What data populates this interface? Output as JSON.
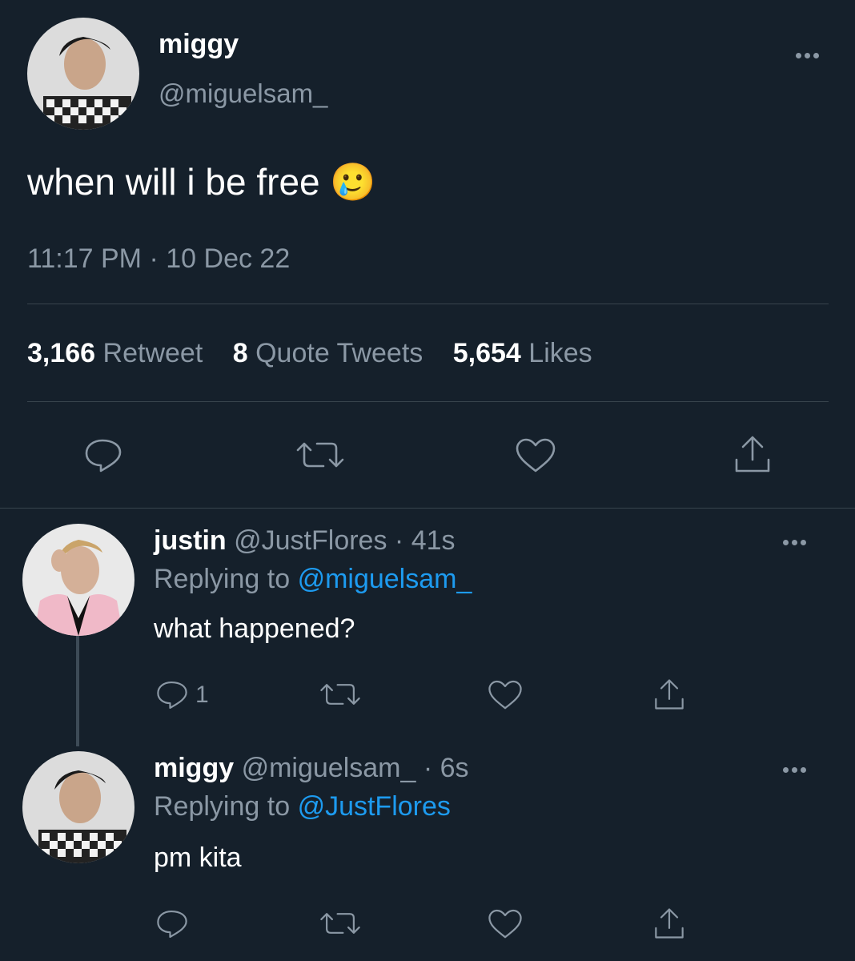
{
  "main_tweet": {
    "display_name": "miggy",
    "handle": "@miguelsam_",
    "text": "when will i be free",
    "emoji": "🥲",
    "time": "11:17 PM",
    "separator": "·",
    "date": "10 Dec 22",
    "stats": {
      "retweets_count": "3,166",
      "retweets_label": "Retweet",
      "quotes_count": "8",
      "quotes_label": "Quote Tweets",
      "likes_count": "5,654",
      "likes_label": "Likes"
    }
  },
  "replies": [
    {
      "display_name": "justin",
      "handle": "@JustFlores",
      "meta": "· 41s",
      "replying_prefix": "Replying to",
      "replying_to": "@miguelsam_",
      "text": "what happened?",
      "reply_count": "1"
    },
    {
      "display_name": "miggy",
      "handle": "@miguelsam_",
      "meta": "· 6s",
      "replying_prefix": "Replying to",
      "replying_to": "@JustFlores",
      "text": "pm kita",
      "reply_count": ""
    }
  ],
  "colors": {
    "background": "#15202b",
    "muted": "#8b98a5",
    "link": "#1d9bf0",
    "divider": "#38444d"
  }
}
